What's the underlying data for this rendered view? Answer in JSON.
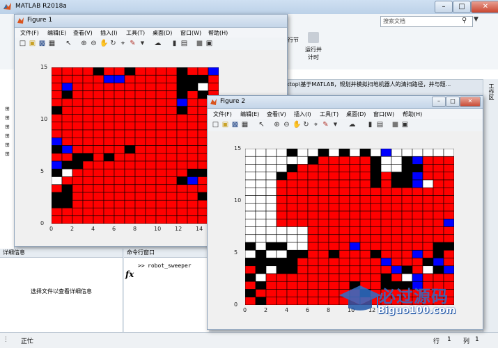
{
  "app": {
    "title": "MATLAB R2018a",
    "search_placeholder": "搜索文档",
    "toolstrip_labels": [
      "行节",
      "运行并",
      "计时"
    ],
    "path_text": "ktop\\基于MATLAB，规划并模拟扫地机器人的清扫路径，并与题...",
    "right_sidebar": "工作区",
    "detail_header": "详细信息",
    "detail_hint": "选择文件以查看详细信息",
    "cmd_header": "命令行窗口",
    "cmd_prompt": ">>",
    "cmd_text": "robot_sweeper",
    "fx": "fx",
    "status_left": "正忙",
    "status_row_label": "行",
    "status_row": "1",
    "status_col_label": "列",
    "status_col": "1"
  },
  "figure1": {
    "title": "Figure 1",
    "menus": [
      "文件(F)",
      "编辑(E)",
      "查看(V)",
      "插入(I)",
      "工具(T)",
      "桌面(D)",
      "窗口(W)",
      "帮助(H)"
    ],
    "xticks": [
      "0",
      "2",
      "4",
      "6",
      "8",
      "10",
      "12",
      "14"
    ],
    "yticks": [
      "0",
      "5",
      "10",
      "15"
    ]
  },
  "figure2": {
    "title": "Figure 2",
    "menus": [
      "文件(F)",
      "编辑(E)",
      "查看(V)",
      "插入(I)",
      "工具(T)",
      "桌面(D)",
      "窗口(W)",
      "帮助(H)"
    ],
    "xticks": [
      "0",
      "2",
      "4",
      "6",
      "8",
      "10",
      "12"
    ],
    "yticks": [
      "0",
      "5",
      "10",
      "15"
    ]
  },
  "watermark": {
    "brand": "必过源码",
    "url": "Biguo100.com"
  },
  "colors": {
    "cleaned": "#ff0000",
    "obstacle": "#000000",
    "robot": "#0000ff",
    "uncleaned": "#ffffff"
  }
}
